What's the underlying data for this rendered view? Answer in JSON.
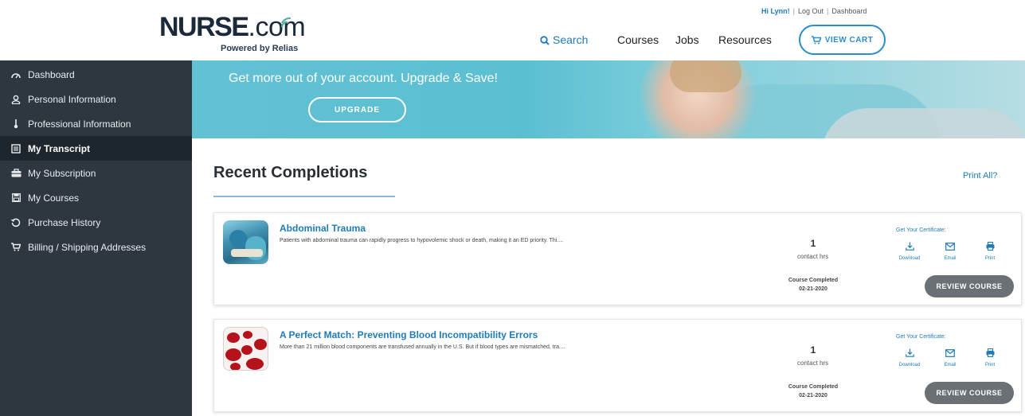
{
  "header": {
    "logo": {
      "brand": "NURSE",
      "suffix": ".com",
      "tagline": "Powered by Relias"
    },
    "account_links": {
      "greeting": "Hi Lynn!",
      "logout": "Log Out",
      "dashboard": "Dashboard"
    },
    "nav": {
      "search": "Search",
      "courses": "Courses",
      "jobs": "Jobs",
      "resources": "Resources"
    },
    "cart_button": "VIEW CART"
  },
  "sidebar": {
    "items": [
      {
        "label": "Dashboard",
        "icon": "gauge-icon"
      },
      {
        "label": "Personal Information",
        "icon": "user-icon"
      },
      {
        "label": "Professional Information",
        "icon": "stethoscope-icon"
      },
      {
        "label": "My Transcript",
        "icon": "transcript-icon",
        "active": true
      },
      {
        "label": "My Subscription",
        "icon": "briefcase-icon"
      },
      {
        "label": "My Courses",
        "icon": "save-icon"
      },
      {
        "label": "Purchase History",
        "icon": "history-icon"
      },
      {
        "label": "Billing / Shipping Addresses",
        "icon": "cart-icon"
      }
    ]
  },
  "banner": {
    "headline": "Get more out of your account. Upgrade & Save!",
    "upgrade_button": "UPGRADE"
  },
  "main": {
    "section_title": "Recent Completions",
    "print_all": "Print All?",
    "courses": [
      {
        "title": "Abdominal Trauma",
        "description": "Patients with abdominal trauma can rapidly progress to hypovolemic shock or death, making it an ED priority. Thi....",
        "hours": "1",
        "hours_label": "contact hrs",
        "completed_label": "Course Completed",
        "completed_date": "02-21-2020",
        "cert_title": "Get Your Certificate:",
        "cert_download": "Download",
        "cert_email": "Email",
        "cert_print": "Print",
        "review_button": "REVIEW COURSE"
      },
      {
        "title": "A Perfect Match: Preventing Blood Incompatibility Errors",
        "description": "More than 21 million blood components are transfused annually in the U.S. But if blood types are mismatched, tra....",
        "hours": "1",
        "hours_label": "contact hrs",
        "completed_label": "Course Completed",
        "completed_date": "02-21-2020",
        "cert_title": "Get Your Certificate:",
        "cert_download": "Download",
        "cert_email": "Email",
        "cert_print": "Print",
        "review_button": "REVIEW COURSE"
      }
    ]
  },
  "colors": {
    "accent_blue": "#1f7bb8",
    "sidebar_bg": "#2e3740",
    "sidebar_active_bg": "#1d252d",
    "banner_teal": "#5bbfd2",
    "review_button_bg": "#6b7075"
  }
}
